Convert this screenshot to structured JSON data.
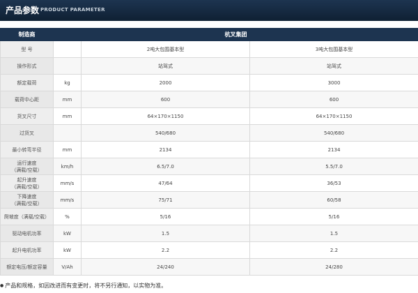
{
  "banner": {
    "title_cn": "产品参数",
    "title_en": "PRODUCT PARAMETER"
  },
  "table": {
    "header": {
      "manufacturer_label": "制造商",
      "manufacturer_value": "杭叉集团"
    },
    "rows": [
      {
        "label": "型  号",
        "unit": "",
        "col1": "2吨大包围基本型",
        "col2": "3吨大包围基本型"
      },
      {
        "label": "操作形式",
        "unit": "",
        "col1": "站驾式",
        "col2": "站驾式"
      },
      {
        "label": "额定载荷",
        "unit": "kg",
        "col1": "2000",
        "col2": "3000"
      },
      {
        "label": "载荷中心距",
        "unit": "mm",
        "col1": "600",
        "col2": "600"
      },
      {
        "label": "货叉尺寸",
        "unit": "mm",
        "col1": "64×170×1150",
        "col2": "64×170×1150"
      },
      {
        "label": "过货叉",
        "unit": "",
        "col1": "540/680",
        "col2": "540/680"
      },
      {
        "label": "最小转弯半径",
        "unit": "mm",
        "col1": "2134",
        "col2": "2134"
      },
      {
        "label": "运行速度",
        "label2": "（满载/空载）",
        "unit": "km/h",
        "col1": "6.5/7.0",
        "col2": "5.5/7.0"
      },
      {
        "label": "起升速度",
        "label2": "（满载/空载）",
        "unit": "mm/s",
        "col1": "47/64",
        "col2": "36/53"
      },
      {
        "label": "下降速度",
        "label2": "（满载/空载）",
        "unit": "mm/s",
        "col1": "75/71",
        "col2": "60/58"
      },
      {
        "label": "爬坡度（满载/空载）",
        "unit": "%",
        "col1": "5/16",
        "col2": "5/16"
      },
      {
        "label": "驱动电机功率",
        "unit": "kW",
        "col1": "1.5",
        "col2": "1.5"
      },
      {
        "label": "起升电机功率",
        "unit": "kW",
        "col1": "2.2",
        "col2": "2.2"
      },
      {
        "label": "额定电压/额定容量",
        "unit": "V/Ah",
        "col1": "24/240",
        "col2": "24/280"
      }
    ]
  },
  "note": {
    "bullet": "●",
    "text": "产品和规格，如因改进而有变更时，将不另行通知，以实物为准。"
  }
}
